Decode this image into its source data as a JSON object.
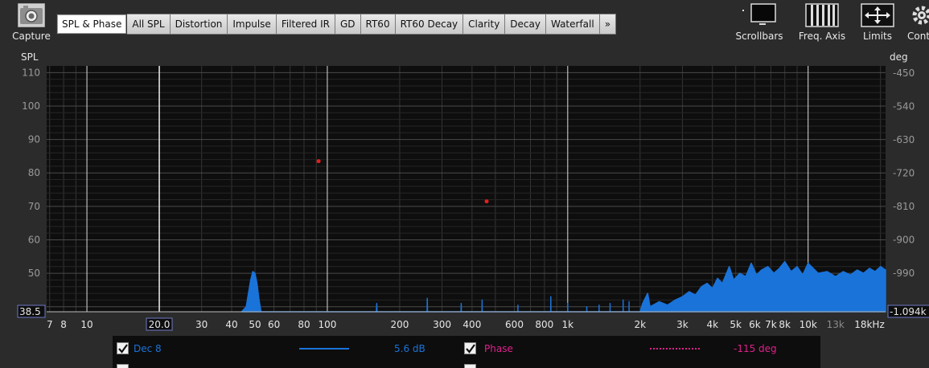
{
  "toolbar": {
    "capture_label": "Capture",
    "tabs": [
      "SPL & Phase",
      "All SPL",
      "Distortion",
      "Impulse",
      "Filtered IR",
      "GD",
      "RT60",
      "RT60 Decay",
      "Clarity",
      "Decay",
      "Waterfall",
      "»"
    ],
    "active_tab": "SPL & Phase",
    "scrollbars_label": "Scrollbars",
    "freq_axis_label": "Freq. Axis",
    "limits_label": "Limits",
    "controls_label": "Cont"
  },
  "chart_data": {
    "type": "line",
    "ylabel_left": "SPL",
    "ylabel_right": "deg",
    "x_scale": "log",
    "xlim": [
      6.8,
      21000
    ],
    "ylim_left": [
      38.5,
      112
    ],
    "ylim_right": [
      -1094,
      -430
    ],
    "x_ticks": [
      {
        "v": 7,
        "label": "7"
      },
      {
        "v": 8,
        "label": "8"
      },
      {
        "v": 10,
        "label": "10"
      },
      {
        "v": 30,
        "label": "30"
      },
      {
        "v": 40,
        "label": "40"
      },
      {
        "v": 50,
        "label": "50"
      },
      {
        "v": 60,
        "label": "60"
      },
      {
        "v": 80,
        "label": "80"
      },
      {
        "v": 100,
        "label": "100"
      },
      {
        "v": 200,
        "label": "200"
      },
      {
        "v": 300,
        "label": "300"
      },
      {
        "v": 400,
        "label": "400"
      },
      {
        "v": 600,
        "label": "600"
      },
      {
        "v": 800,
        "label": "800"
      },
      {
        "v": 1000,
        "label": "1k"
      },
      {
        "v": 2000,
        "label": "2k"
      },
      {
        "v": 3000,
        "label": "3k"
      },
      {
        "v": 4000,
        "label": "4k"
      },
      {
        "v": 5000,
        "label": "5k"
      },
      {
        "v": 6000,
        "label": "6k"
      },
      {
        "v": 7000,
        "label": "7k"
      },
      {
        "v": 8000,
        "label": "8k"
      },
      {
        "v": 10000,
        "label": "10k"
      },
      {
        "v": 13000,
        "label": "13k"
      },
      {
        "v": 18000,
        "label": "18kHz"
      }
    ],
    "x_cursor": {
      "v": 20,
      "label": "20.0"
    },
    "y_ticks_left": [
      50,
      60,
      70,
      80,
      90,
      100,
      110
    ],
    "y_cursor_left": "38.5",
    "y_ticks_right": [
      {
        "v": -990,
        "label": "-990"
      },
      {
        "v": -900,
        "label": "-900"
      },
      {
        "v": -810,
        "label": "-810"
      },
      {
        "v": -720,
        "label": "-720"
      },
      {
        "v": -630,
        "label": "-630"
      },
      {
        "v": -540,
        "label": "-540"
      },
      {
        "v": -450,
        "label": "-450"
      }
    ],
    "y_cursor_right": "-1.094k",
    "series": [
      {
        "name": "Dec 8",
        "color": "#1a73d9",
        "values_desc": "SPL spectrum",
        "points": [
          [
            44,
            38.5
          ],
          [
            46,
            40
          ],
          [
            47,
            44
          ],
          [
            48,
            48
          ],
          [
            49,
            50.5
          ],
          [
            50,
            50
          ],
          [
            51,
            47
          ],
          [
            52,
            42
          ],
          [
            53,
            38.5
          ],
          [
            160,
            38.5
          ],
          [
            160.5,
            41
          ],
          [
            161,
            38.5
          ],
          [
            260,
            38.5
          ],
          [
            260.5,
            42.5
          ],
          [
            261,
            38.5
          ],
          [
            360,
            38.5
          ],
          [
            360.5,
            41
          ],
          [
            361,
            38.5
          ],
          [
            440,
            38.5
          ],
          [
            440.5,
            42
          ],
          [
            441,
            38.5
          ],
          [
            620,
            38.5
          ],
          [
            620.5,
            40.5
          ],
          [
            621,
            38.5
          ],
          [
            850,
            38.5
          ],
          [
            850.5,
            43
          ],
          [
            851,
            38.5
          ],
          [
            1000,
            38.5
          ],
          [
            1000.5,
            41
          ],
          [
            1001,
            38.5
          ],
          [
            1200,
            38.5
          ],
          [
            1200.5,
            40
          ],
          [
            1201,
            38.5
          ],
          [
            1350,
            38.5
          ],
          [
            1350.5,
            40.5
          ],
          [
            1351,
            38.5
          ],
          [
            1500,
            38.5
          ],
          [
            1500.5,
            41
          ],
          [
            1501,
            38.5
          ],
          [
            1700,
            38.5
          ],
          [
            1700.5,
            42
          ],
          [
            1701,
            38.5
          ],
          [
            1800,
            38.5
          ],
          [
            1800.5,
            41.5
          ],
          [
            1801,
            38.5
          ],
          [
            2000,
            38.5
          ],
          [
            2050,
            41
          ],
          [
            2150,
            44
          ],
          [
            2200,
            40
          ],
          [
            2400,
            41.5
          ],
          [
            2600,
            40.5
          ],
          [
            2800,
            42
          ],
          [
            3000,
            43
          ],
          [
            3200,
            44.5
          ],
          [
            3400,
            43.5
          ],
          [
            3600,
            46
          ],
          [
            3800,
            47
          ],
          [
            4000,
            45.5
          ],
          [
            4200,
            48.5
          ],
          [
            4400,
            47
          ],
          [
            4700,
            52
          ],
          [
            4900,
            48
          ],
          [
            5200,
            50
          ],
          [
            5500,
            49
          ],
          [
            5800,
            53
          ],
          [
            6100,
            49.5
          ],
          [
            6400,
            51
          ],
          [
            6800,
            52
          ],
          [
            7200,
            50
          ],
          [
            7600,
            51.5
          ],
          [
            8000,
            53.5
          ],
          [
            8500,
            50.5
          ],
          [
            9000,
            52
          ],
          [
            9500,
            49.5
          ],
          [
            10000,
            53
          ],
          [
            11000,
            50
          ],
          [
            12000,
            50.5
          ],
          [
            13000,
            49
          ],
          [
            14000,
            50.5
          ],
          [
            15000,
            49.5
          ],
          [
            16000,
            51
          ],
          [
            17000,
            50
          ],
          [
            18000,
            51.5
          ],
          [
            19000,
            50.5
          ],
          [
            20000,
            52
          ],
          [
            21000,
            51
          ]
        ]
      }
    ],
    "markers": [
      {
        "x": 92,
        "y": 83.5,
        "color": "#e02020"
      },
      {
        "x": 460,
        "y": 71.5,
        "color": "#e02020"
      }
    ],
    "grid": true
  },
  "legend": {
    "items": [
      {
        "name": "Dec 8",
        "value": "5.6 dB",
        "color": "#1a73d9",
        "checked": true
      },
      {
        "name": "Phase",
        "value": "-115 deg",
        "color": "#e0208a",
        "checked": true
      }
    ]
  }
}
